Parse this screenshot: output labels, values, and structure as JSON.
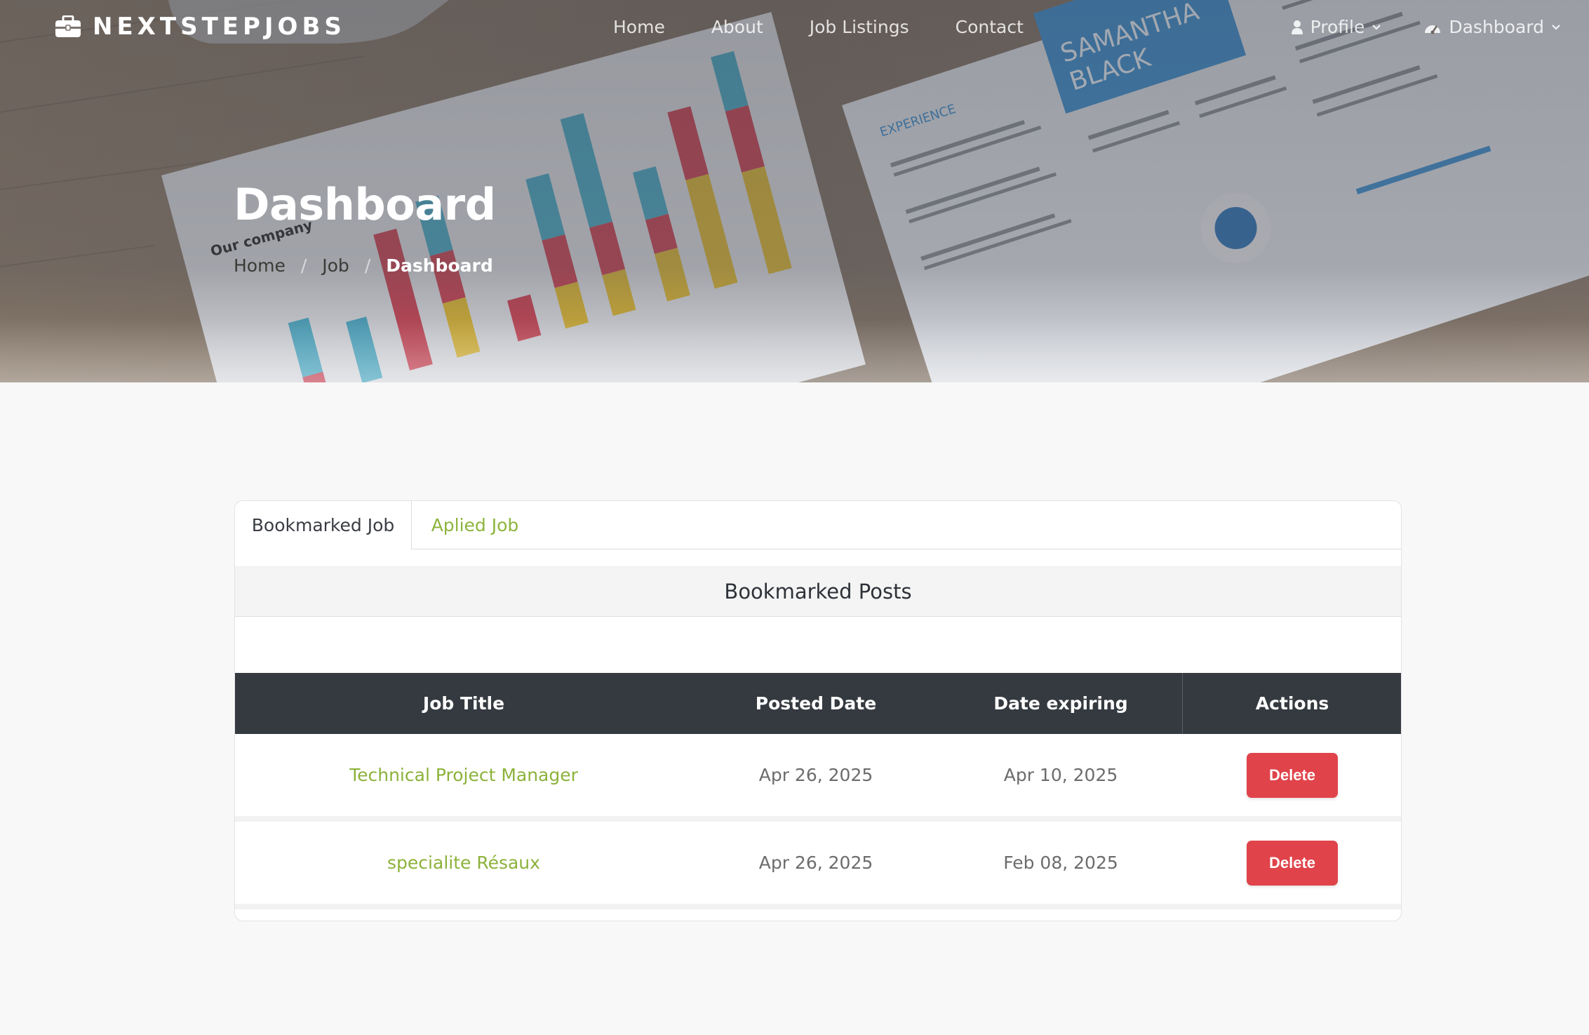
{
  "nav": {
    "brand": "NEXTSTEPJOBS",
    "links": [
      "Home",
      "About",
      "Job Listings",
      "Contact"
    ],
    "profile_label": "Profile",
    "dashboard_label": "Dashboard"
  },
  "hero": {
    "title": "Dashboard",
    "breadcrumb": [
      "Home",
      "Job",
      "Dashboard"
    ]
  },
  "tabs": [
    "Bookmarked Job",
    "Aplied Job"
  ],
  "section_title": "Bookmarked Posts",
  "table": {
    "headers": [
      "Job Title",
      "Posted Date",
      "Date expiring",
      "Actions"
    ],
    "rows": [
      {
        "title": "Technical Project Manager",
        "posted": "Apr 26, 2025",
        "expiring": "Apr 10, 2025",
        "action": "Delete"
      },
      {
        "title": "specialite Résaux",
        "posted": "Apr 26, 2025",
        "expiring": "Feb 08, 2025",
        "action": "Delete"
      }
    ]
  },
  "colors": {
    "accent_green": "#8cb23a",
    "table_header": "#343a40",
    "delete_red": "#e0434a"
  }
}
